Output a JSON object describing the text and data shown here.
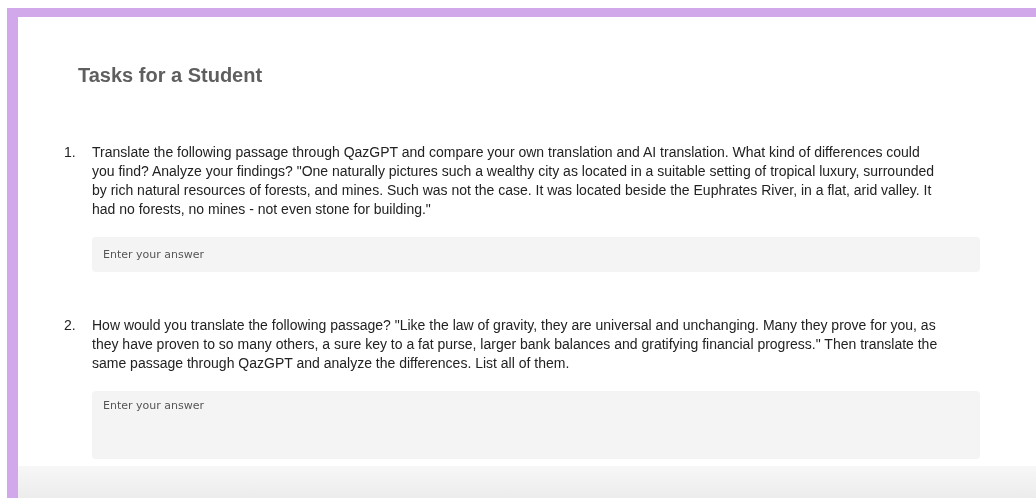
{
  "title": "Tasks for a Student",
  "tasks": [
    {
      "number": "1.",
      "text": "Translate the following passage through QazGPT and compare your own translation and AI translation. What kind of differences could you find? Analyze your findings? \"One naturally pictures such a wealthy city as located in a suitable setting of tropical luxury, surrounded by rich natural resources of forests, and mines. Such was not the case. It was located beside the Euphrates River, in a flat, arid valley. It had no forests, no mines - not even stone for building.\"",
      "answer": {
        "kind": "line",
        "placeholder": "Enter your answer"
      }
    },
    {
      "number": "2.",
      "text": "How would you translate the following passage? \"Like the law of gravity, they are universal and unchanging. Many they prove for you, as they have proven to so many others, a sure key to a fat purse, larger bank balances and gratifying financial progress.\" Then translate the same passage through QazGPT and analyze the differences. List all of them.",
      "answer": {
        "kind": "area",
        "placeholder": "Enter your answer"
      }
    }
  ]
}
